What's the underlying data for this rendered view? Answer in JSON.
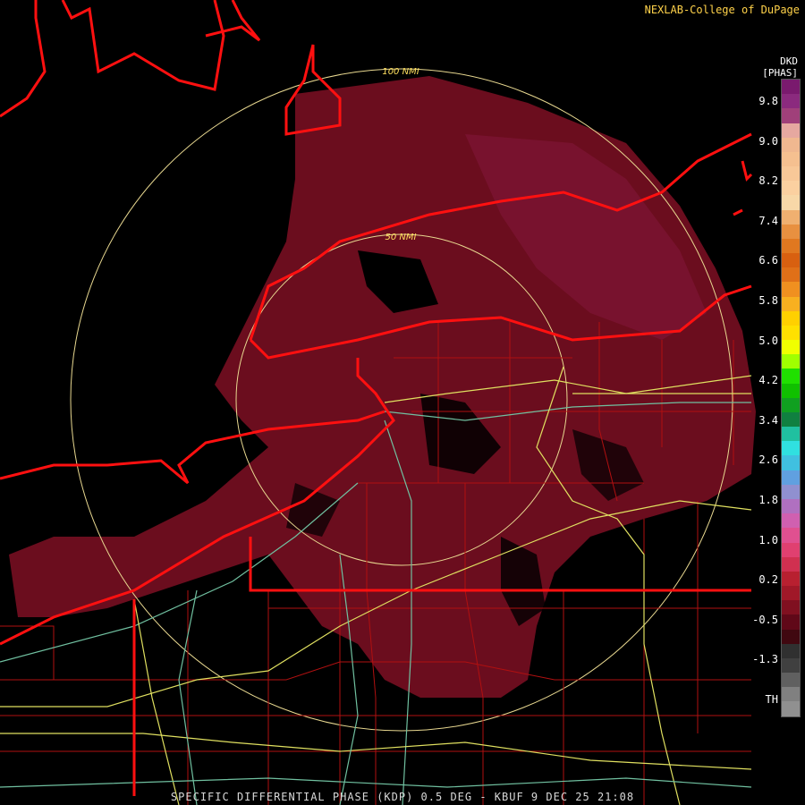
{
  "credit": "NEXLAB-College of DuPage",
  "legend": {
    "unit_top": "DKD",
    "unit_label": "[PHAS]",
    "ticks": [
      "9.8",
      "9.0",
      "8.2",
      "7.4",
      "6.6",
      "5.8",
      "5.0",
      "4.2",
      "3.4",
      "2.6",
      "1.8",
      "1.0",
      "0.2",
      "-0.5",
      "-1.3",
      "TH"
    ],
    "colors": [
      "#7a1a6e",
      "#8b2a7e",
      "#a0407a",
      "#e6a8a0",
      "#f0b890",
      "#f5c090",
      "#f8c898",
      "#fbd0a0",
      "#f8d8a8",
      "#f0b070",
      "#e89040",
      "#e07820",
      "#d86010",
      "#e07018",
      "#f09020",
      "#f8b020",
      "#ffd000",
      "#ffe000",
      "#f0ff00",
      "#a0ff00",
      "#20e000",
      "#10c000",
      "#10a020",
      "#108040",
      "#20c0a0",
      "#30e0e0",
      "#40c0e0",
      "#60a0e0",
      "#9090d0",
      "#b070c0",
      "#d060b0",
      "#e05090",
      "#e04070",
      "#d03050",
      "#b82030",
      "#a01828",
      "#801020",
      "#600818",
      "#400810",
      "#303030",
      "#404040",
      "#606060",
      "#808080",
      "#909090"
    ]
  },
  "range_rings": [
    "100 NMI",
    "50 NMI"
  ],
  "footer": "SPECIFIC DIFFERENTIAL PHASE (KDP) 0.5 DEG - KBUF 9 DEC 25 21:08"
}
